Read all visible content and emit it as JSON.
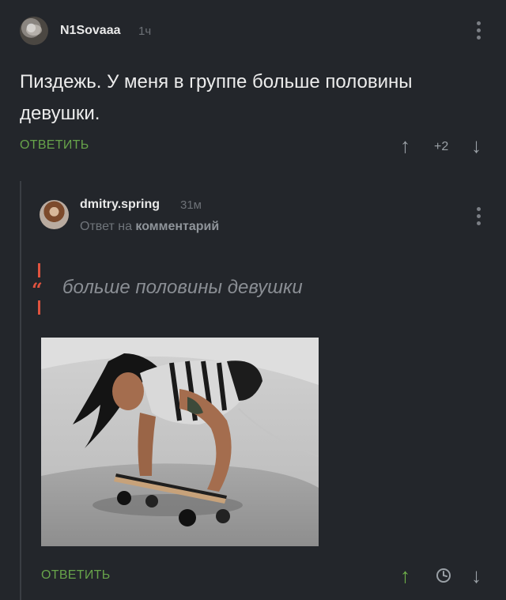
{
  "comment": {
    "username": "N1Sovaaa",
    "time": "1ч",
    "text": "Пиздежь. У меня в группе больше половины девушки.",
    "reply_label": "ОТВЕТИТЬ",
    "score": "+2"
  },
  "reply": {
    "username": "dmitry.spring",
    "time": "31м",
    "reply_to_prefix": "Ответ на",
    "reply_to_target": "комментарий",
    "quote_mark": "“",
    "quote": "больше половины девушки",
    "reply_label": "ОТВЕТИТЬ"
  },
  "colors": {
    "background": "#23262b",
    "accent_green": "#67a34a",
    "quote_red": "#e0533f"
  },
  "icons": {
    "upvote": "arrow-up-icon",
    "downvote": "arrow-down-icon",
    "more": "more-vertical-icon",
    "saved": "clock-icon"
  }
}
